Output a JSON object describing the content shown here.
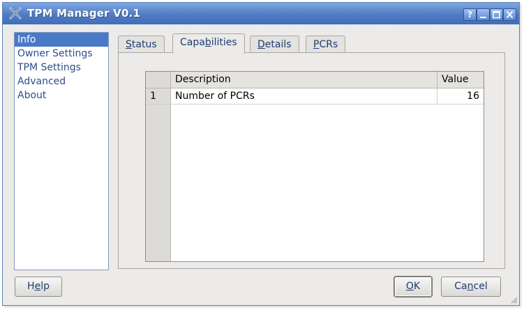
{
  "window": {
    "title": "TPM Manager V0.1",
    "title_buttons": [
      "?",
      "_",
      "□",
      "✕"
    ]
  },
  "sidebar": {
    "items": [
      {
        "label": "Info",
        "selected": true
      },
      {
        "label": "Owner Settings",
        "selected": false
      },
      {
        "label": "TPM Settings",
        "selected": false
      },
      {
        "label": "Advanced",
        "selected": false
      },
      {
        "label": "About",
        "selected": false
      }
    ]
  },
  "tabs": [
    {
      "label": "Status",
      "mnemonic": "S",
      "active": false
    },
    {
      "label": "Capabilities",
      "mnemonic": "b",
      "active": true
    },
    {
      "label": "Details",
      "mnemonic": "D",
      "active": false
    },
    {
      "label": "PCRs",
      "mnemonic": "P",
      "active": false
    }
  ],
  "table": {
    "columns": [
      "Description",
      "Value"
    ],
    "rows": [
      {
        "num": "1",
        "description": "Number of PCRs",
        "value": "16"
      }
    ]
  },
  "buttons": {
    "help": "Help",
    "ok": "OK",
    "cancel": "Cancel"
  },
  "colors": {
    "titlebar": "#4f7cc4",
    "selection": "#4a79c7",
    "link_text": "#2b4e8a"
  }
}
